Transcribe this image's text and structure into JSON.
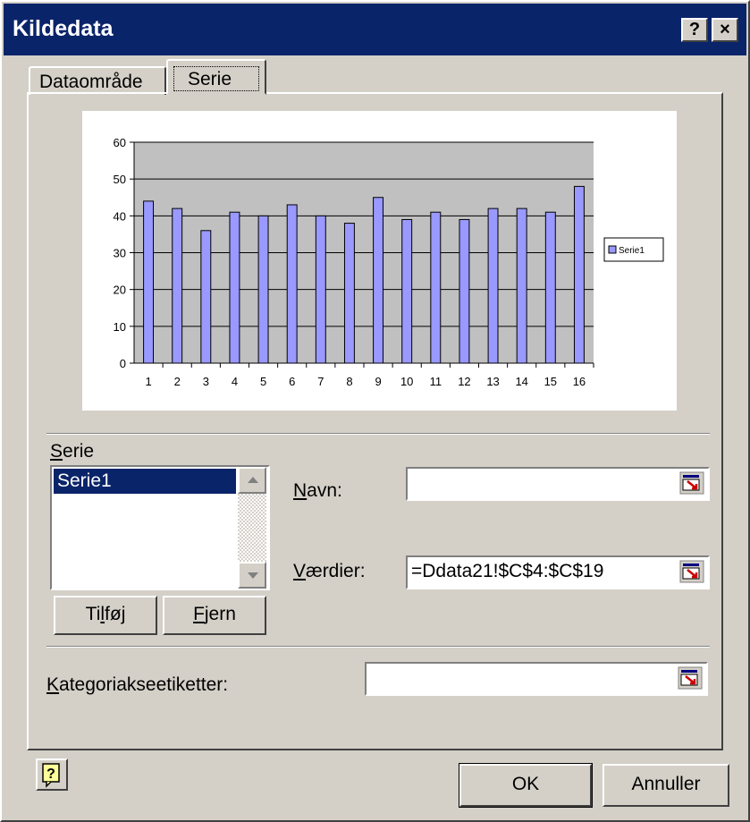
{
  "window": {
    "title": "Kildedata",
    "help_glyph": "?",
    "close_glyph": "×"
  },
  "tabs": [
    {
      "label": "Dataområde",
      "active": false
    },
    {
      "label": "Serie",
      "active": true
    }
  ],
  "chart_data": {
    "type": "bar",
    "categories": [
      "1",
      "2",
      "3",
      "4",
      "5",
      "6",
      "7",
      "8",
      "9",
      "10",
      "11",
      "12",
      "13",
      "14",
      "15",
      "16"
    ],
    "series": [
      {
        "name": "Serie1",
        "values": [
          44,
          42,
          36,
          41,
          40,
          43,
          40,
          38,
          45,
          39,
          41,
          39,
          42,
          42,
          41,
          48
        ],
        "color": "#9999ff"
      }
    ],
    "ylim": [
      0,
      60
    ],
    "yticks": [
      "0",
      "10",
      "20",
      "30",
      "40",
      "50",
      "60"
    ],
    "grid": true,
    "plot_background": "#c0c0c0",
    "legend": "right"
  },
  "series_section": {
    "label_prefix": "S",
    "label_rest": "erie",
    "items": [
      "Serie1"
    ],
    "selected": "Serie1"
  },
  "fields": {
    "name_label_u": "N",
    "name_label_rest": "avn:",
    "name_value": "",
    "values_label_u": "V",
    "values_label_rest": "ærdier:",
    "values_value": "=Ddata21!$C$4:$C$19",
    "category_label_u": "K",
    "category_label_rest": "ategoriakseetiketter:",
    "category_value": ""
  },
  "buttons": {
    "add_pre": "Ti",
    "add_u": "l",
    "add_post": "føj",
    "remove_u": "F",
    "remove_post": "jern",
    "ok": "OK",
    "cancel": "Annuller"
  },
  "icons": {
    "help_icon": "help-question-icon",
    "range_icon": "collapse-dialog-icon"
  },
  "colors": {
    "titlebar": "#0a246a",
    "face": "#d4d0c8",
    "selection": "#0a246a",
    "bars": "#9999ff"
  }
}
